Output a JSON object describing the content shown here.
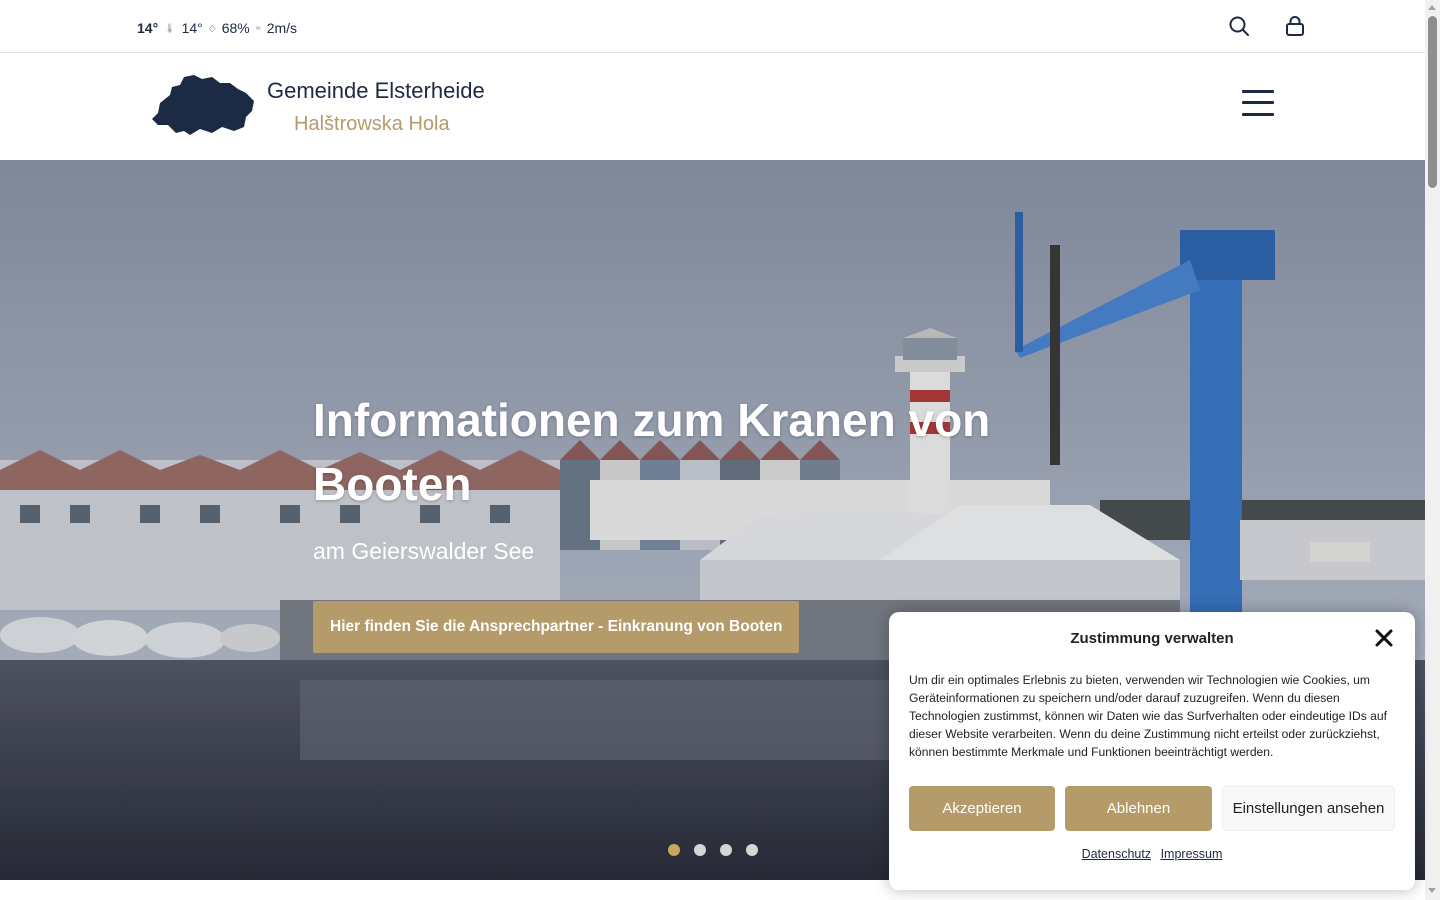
{
  "weather": {
    "temp_main": "14°",
    "feels_like": "14°",
    "humidity": "68%",
    "wind": "2m/s",
    "icons": [
      "thermometer-icon",
      "droplet-icon",
      "wind-icon"
    ]
  },
  "topbar_icons": [
    "search-icon",
    "lock-icon"
  ],
  "header": {
    "title": "Gemeinde Elsterheide",
    "subtitle": "Halštrowska Hola",
    "logo": "municipality-map-logo",
    "menu_icon": "hamburger-menu-icon"
  },
  "hero": {
    "title": "Informationen zum Kranen von Booten",
    "subtitle": "am Geierswalder See",
    "button_label": "Hier finden Sie die Ansprechpartner - Einkranung von Booten",
    "slides_count": 4,
    "active_slide": 1
  },
  "cookie": {
    "title": "Zustimmung verwalten",
    "text": "Um dir ein optimales Erlebnis zu bieten, verwenden wir Technologien wie Cookies, um Geräteinformationen zu speichern und/oder darauf zuzugreifen. Wenn du diesen Technologien zustimmst, können wir Daten wie das Surfverhalten oder eindeutige IDs auf dieser Website verarbeiten. Wenn du deine Zustimmung nicht erteilst oder zurückziehst, können bestimmte Merkmale und Funktionen beeinträchtigt werden.",
    "accept": "Akzeptieren",
    "deny": "Ablehnen",
    "settings": "Einstellungen ansehen",
    "link_privacy": "Datenschutz",
    "link_imprint": "Impressum"
  },
  "colors": {
    "navy": "#1c2a44",
    "gold": "#b59b6a",
    "dot_active": "#c9a85e",
    "dot_inactive": "#d6d6d6"
  }
}
